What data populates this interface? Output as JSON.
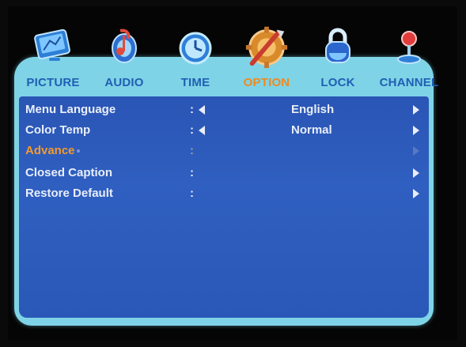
{
  "tabs": [
    {
      "label": "PICTURE",
      "icon": "monitor-icon",
      "active": false
    },
    {
      "label": "AUDIO",
      "icon": "music-note-icon",
      "active": false
    },
    {
      "label": "TIME",
      "icon": "clock-icon",
      "active": false
    },
    {
      "label": "OPTION",
      "icon": "wrench-gear-icon",
      "active": true
    },
    {
      "label": "LOCK",
      "icon": "padlock-icon",
      "active": false
    },
    {
      "label": "CHANNEL",
      "icon": "antenna-icon",
      "active": false
    }
  ],
  "rows": [
    {
      "label": "Menu Language",
      "colon": ":",
      "value": "English",
      "has_left_arrow": true,
      "has_right_arrow": true,
      "highlighted": false
    },
    {
      "label": "Color Temp",
      "colon": ":",
      "value": "Normal",
      "has_left_arrow": true,
      "has_right_arrow": true,
      "highlighted": false
    },
    {
      "label": "Advance",
      "colon": ":",
      "value": "",
      "has_left_arrow": false,
      "has_right_arrow": true,
      "highlighted": true
    },
    {
      "label": "Closed Caption",
      "colon": ":",
      "value": "",
      "has_left_arrow": false,
      "has_right_arrow": true,
      "highlighted": false
    },
    {
      "label": "Restore Default",
      "colon": ":",
      "value": "",
      "has_left_arrow": false,
      "has_right_arrow": true,
      "highlighted": false
    }
  ],
  "colors": {
    "panel": "#7fd3e6",
    "content": "#2f5fc0",
    "tab_label": "#1f5fb3",
    "active_tab_label": "#f08a1c",
    "highlight_text": "#f39a2a"
  }
}
